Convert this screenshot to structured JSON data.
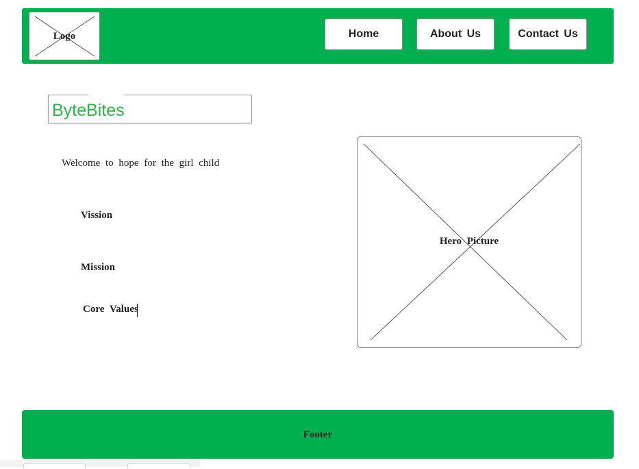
{
  "header": {
    "logo_label": "Logo",
    "nav": {
      "home": "Home",
      "about": "About Us",
      "contact": "Contact Us"
    }
  },
  "brand": {
    "name": "ByteBites"
  },
  "content": {
    "welcome": "Welcome to hope for the girl child",
    "links": {
      "vision": "Vission",
      "mission": "Mission",
      "core_values": "Core Values"
    }
  },
  "hero": {
    "label": "Hero Picture"
  },
  "footer": {
    "label": "Footer"
  },
  "colors": {
    "primary_green": "#00b050",
    "brand_green": "#2fb34a"
  }
}
